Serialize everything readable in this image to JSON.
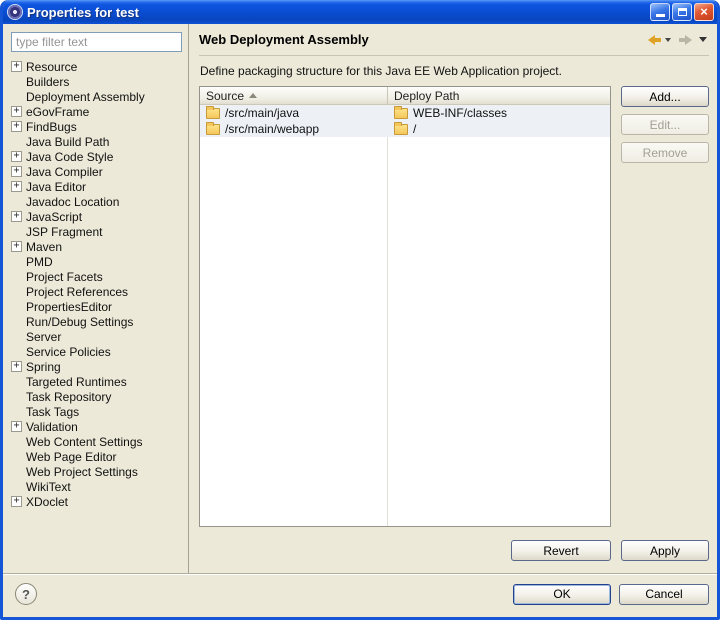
{
  "window": {
    "title": "Properties for test"
  },
  "icons": {
    "close": "×",
    "help": "?"
  },
  "sidebar": {
    "filter_placeholder": "type filter text",
    "items": [
      {
        "label": "Resource",
        "glyph": "+"
      },
      {
        "label": "Builders",
        "glyph": ""
      },
      {
        "label": "Deployment Assembly",
        "glyph": ""
      },
      {
        "label": "eGovFrame",
        "glyph": "+"
      },
      {
        "label": "FindBugs",
        "glyph": "+"
      },
      {
        "label": "Java Build Path",
        "glyph": ""
      },
      {
        "label": "Java Code Style",
        "glyph": "+"
      },
      {
        "label": "Java Compiler",
        "glyph": "+"
      },
      {
        "label": "Java Editor",
        "glyph": "+"
      },
      {
        "label": "Javadoc Location",
        "glyph": ""
      },
      {
        "label": "JavaScript",
        "glyph": "+"
      },
      {
        "label": "JSP Fragment",
        "glyph": ""
      },
      {
        "label": "Maven",
        "glyph": "+"
      },
      {
        "label": "PMD",
        "glyph": ""
      },
      {
        "label": "Project Facets",
        "glyph": ""
      },
      {
        "label": "Project References",
        "glyph": ""
      },
      {
        "label": "PropertiesEditor",
        "glyph": ""
      },
      {
        "label": "Run/Debug Settings",
        "glyph": ""
      },
      {
        "label": "Server",
        "glyph": ""
      },
      {
        "label": "Service Policies",
        "glyph": ""
      },
      {
        "label": "Spring",
        "glyph": "+"
      },
      {
        "label": "Targeted Runtimes",
        "glyph": ""
      },
      {
        "label": "Task Repository",
        "glyph": ""
      },
      {
        "label": "Task Tags",
        "glyph": ""
      },
      {
        "label": "Validation",
        "glyph": "+"
      },
      {
        "label": "Web Content Settings",
        "glyph": ""
      },
      {
        "label": "Web Page Editor",
        "glyph": ""
      },
      {
        "label": "Web Project Settings",
        "glyph": ""
      },
      {
        "label": "WikiText",
        "glyph": ""
      },
      {
        "label": "XDoclet",
        "glyph": "+"
      }
    ]
  },
  "page": {
    "title": "Web Deployment Assembly",
    "description": "Define packaging structure for this Java EE Web Application project.",
    "table": {
      "columns": [
        "Source",
        "Deploy Path"
      ],
      "rows": [
        {
          "source": "/src/main/java",
          "deploy": "WEB-INF/classes"
        },
        {
          "source": "/src/main/webapp",
          "deploy": "/"
        }
      ]
    },
    "buttons": {
      "add": "Add...",
      "edit": "Edit...",
      "remove": "Remove",
      "revert": "Revert",
      "apply": "Apply"
    }
  },
  "footer": {
    "ok": "OK",
    "cancel": "Cancel"
  }
}
